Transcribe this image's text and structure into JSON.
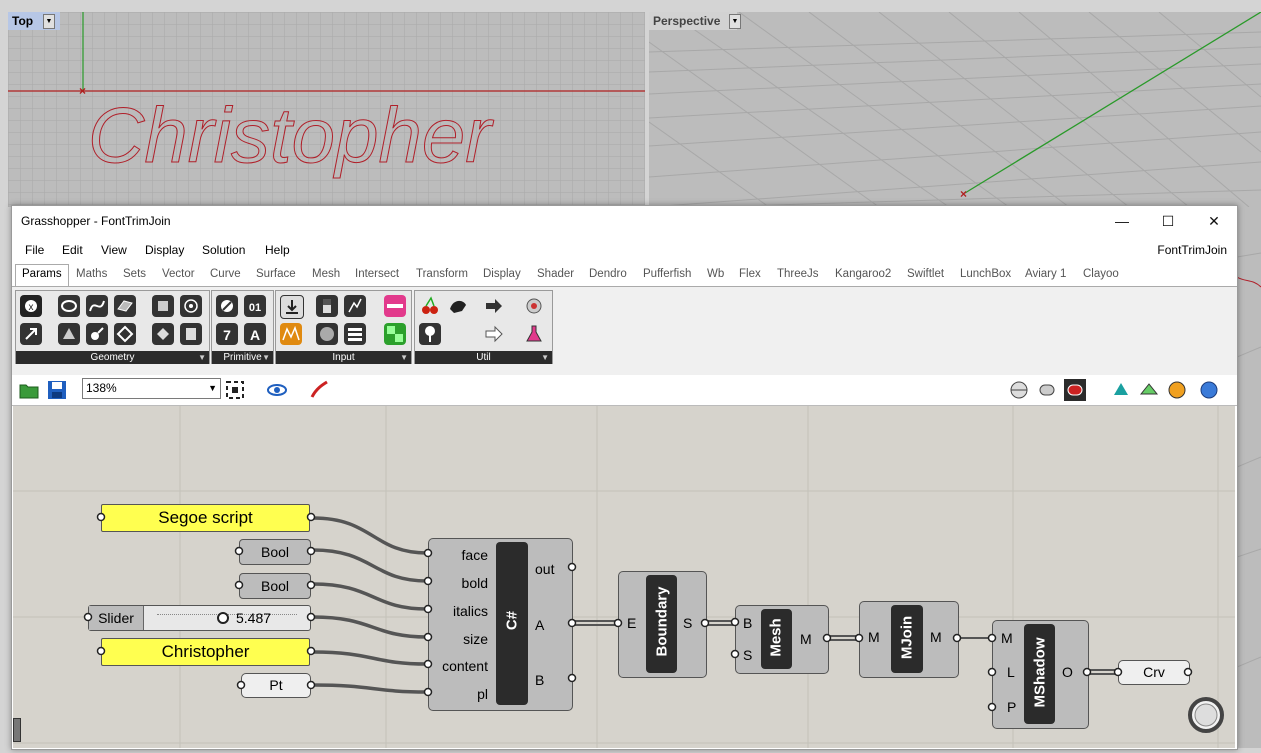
{
  "viewports": {
    "top_label": "Top",
    "perspective_label": "Perspective",
    "text_preview": "Christopher"
  },
  "window": {
    "title": "Grasshopper - FontTrimJoin",
    "document_name": "FontTrimJoin",
    "controls": {
      "minimize": "—",
      "maximize": "☐",
      "close": "✕"
    }
  },
  "menu": [
    "File",
    "Edit",
    "View",
    "Display",
    "Solution",
    "Help"
  ],
  "tabs": [
    "Params",
    "Maths",
    "Sets",
    "Vector",
    "Curve",
    "Surface",
    "Mesh",
    "Intersect",
    "Transform",
    "Display",
    "Shader",
    "Dendro",
    "Pufferfish",
    "Wb",
    "Flex",
    "ThreeJs",
    "Kangaroo2",
    "Swiftlet",
    "LunchBox",
    "Aviary 1",
    "Clayoo"
  ],
  "active_tab": "Params",
  "ribbon_groups": [
    "Geometry",
    "Primitive",
    "Input",
    "Util"
  ],
  "toolbar": {
    "zoom": "138%"
  },
  "canvas": {
    "panel_font": "Segoe script",
    "toggle1": "Bool",
    "toggle2": "Bool",
    "slider_label": "Slider",
    "slider_value": "5.487",
    "slider_fraction": 0.47,
    "panel_text": "Christopher",
    "point_param": "Pt",
    "csharp": {
      "name": "C#",
      "inputs": [
        "face",
        "bold",
        "italics",
        "size",
        "content",
        "pl"
      ],
      "outputs": [
        "out",
        "A",
        "B"
      ]
    },
    "boundary": {
      "name": "Boundary",
      "input": "E",
      "output": "S"
    },
    "mesh": {
      "name": "Mesh",
      "inputs": [
        "B",
        "S"
      ],
      "output": "M"
    },
    "mjoin": {
      "name": "MJoin",
      "input": "M",
      "output": "M"
    },
    "mshadow": {
      "name": "MShadow",
      "inputs": [
        "M",
        "L",
        "P"
      ],
      "output": "O"
    },
    "crv": "Crv"
  },
  "colors": {
    "panel_yellow": "#ffff50",
    "component_grey": "#bcbcbc",
    "wire": "#555555",
    "curve_red": "#b0202a"
  }
}
